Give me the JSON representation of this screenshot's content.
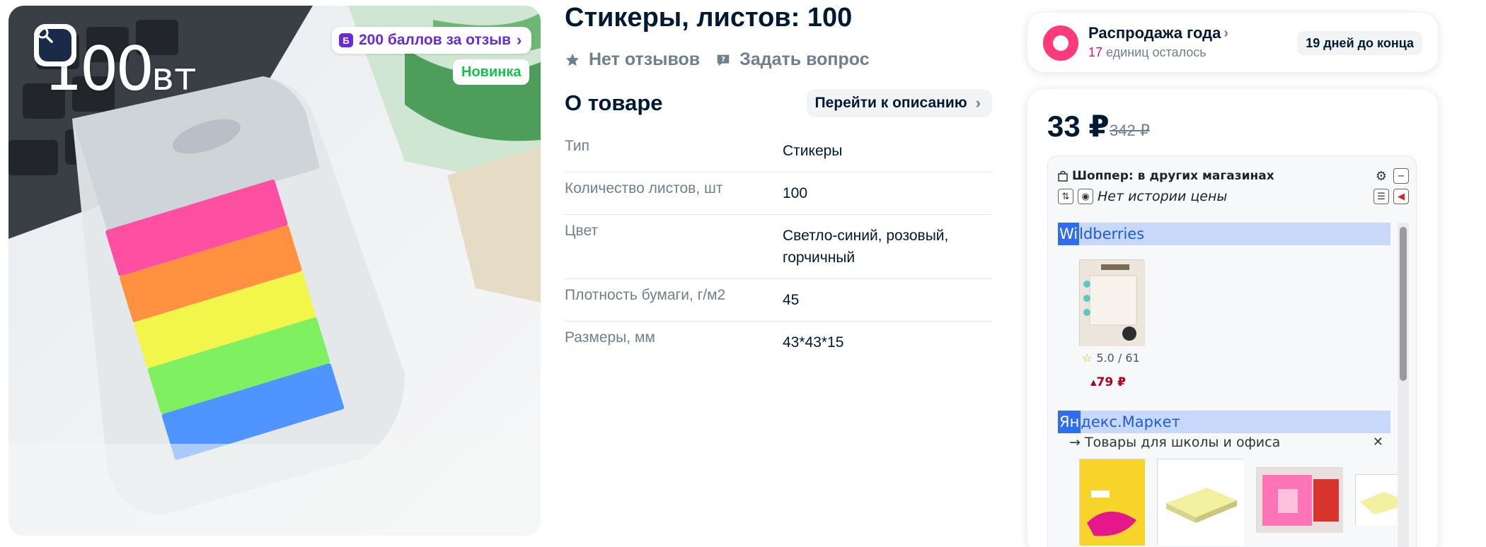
{
  "gallery": {
    "watermark_main": "100",
    "watermark_unit": "вт",
    "bonus_text": "200 баллов за отзыв",
    "new_badge": "Новинка"
  },
  "product": {
    "title": "Стикеры, листов: 100",
    "reviews_label": "Нет отзывов",
    "ask_label": "Задать вопрос"
  },
  "about": {
    "heading": "О товаре",
    "to_description": "Перейти к описанию",
    "specs": [
      {
        "key": "Тип",
        "value": "Стикеры"
      },
      {
        "key": "Количество листов, шт",
        "value": "100"
      },
      {
        "key": "Цвет",
        "value": "Светло-синий, розовый, горчичный"
      },
      {
        "key": "Плотность бумаги, г/м2",
        "value": "45"
      },
      {
        "key": "Размеры, мм",
        "value": "43*43*15"
      }
    ]
  },
  "sale": {
    "title": "Распродажа года",
    "units_count": "17",
    "units_label": "единиц осталось",
    "days_left": "19 дней до конца",
    "accent": "#f91155"
  },
  "price": {
    "current": "33 ₽",
    "old": "342 ₽"
  },
  "shopper": {
    "title_prefix": "Шоппер:",
    "title_rest": "в других магазинах",
    "no_history": "Нет истории цены",
    "stores": [
      {
        "highlight": "Wi",
        "rest": "ldberries"
      },
      {
        "highlight": "Ян",
        "rest": "декс.Маркет"
      }
    ],
    "wb_rating": "5.0 / 61",
    "wb_price": "79 ₽",
    "ym_category": "→ Товары для школы и офиса"
  }
}
